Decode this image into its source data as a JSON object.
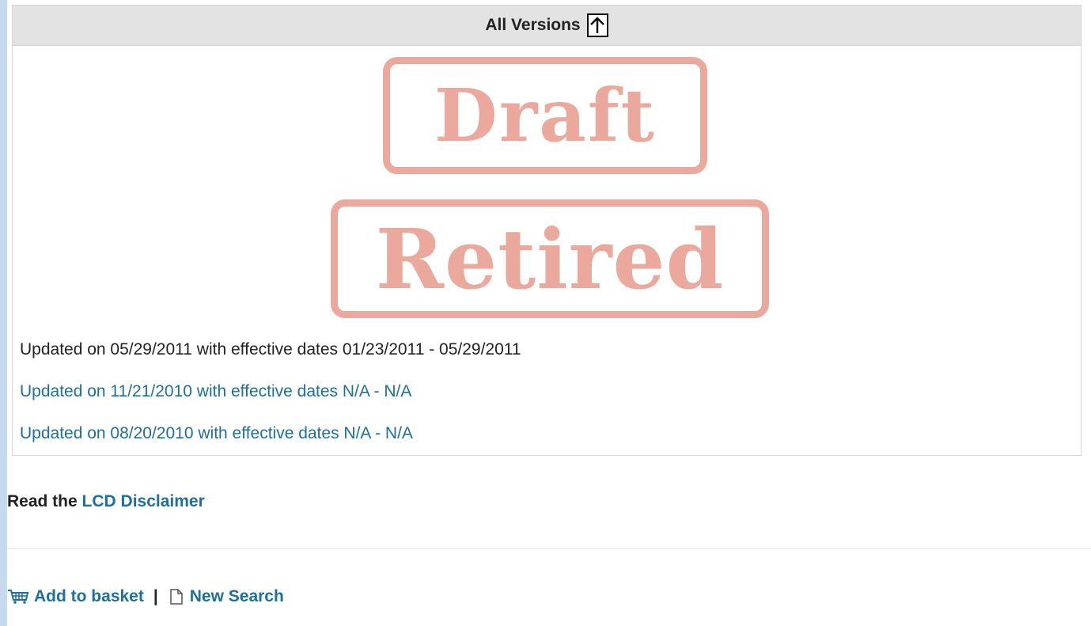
{
  "versions": {
    "header_title": "All Versions",
    "stamps": [
      "Draft",
      "Retired"
    ],
    "current": "Updated on 05/29/2011 with effective dates 01/23/2011 - 05/29/2011",
    "links": [
      "Updated on 11/21/2010 with effective dates N/A - N/A",
      "Updated on 08/20/2010 with effective dates N/A - N/A"
    ]
  },
  "disclaimer": {
    "prefix": "Read the",
    "link": "LCD Disclaimer"
  },
  "actions": {
    "add_to_basket": "Add to basket",
    "separator": "|",
    "new_search": "New Search"
  },
  "icons": {
    "up": "arrow-up-icon",
    "basket": "basket-icon",
    "new_search": "document-icon"
  },
  "colors": {
    "link": "#1d6f9e",
    "stamp": "#eaa99c",
    "frame": "#c5daef",
    "header_bg": "#e3e3e3"
  }
}
